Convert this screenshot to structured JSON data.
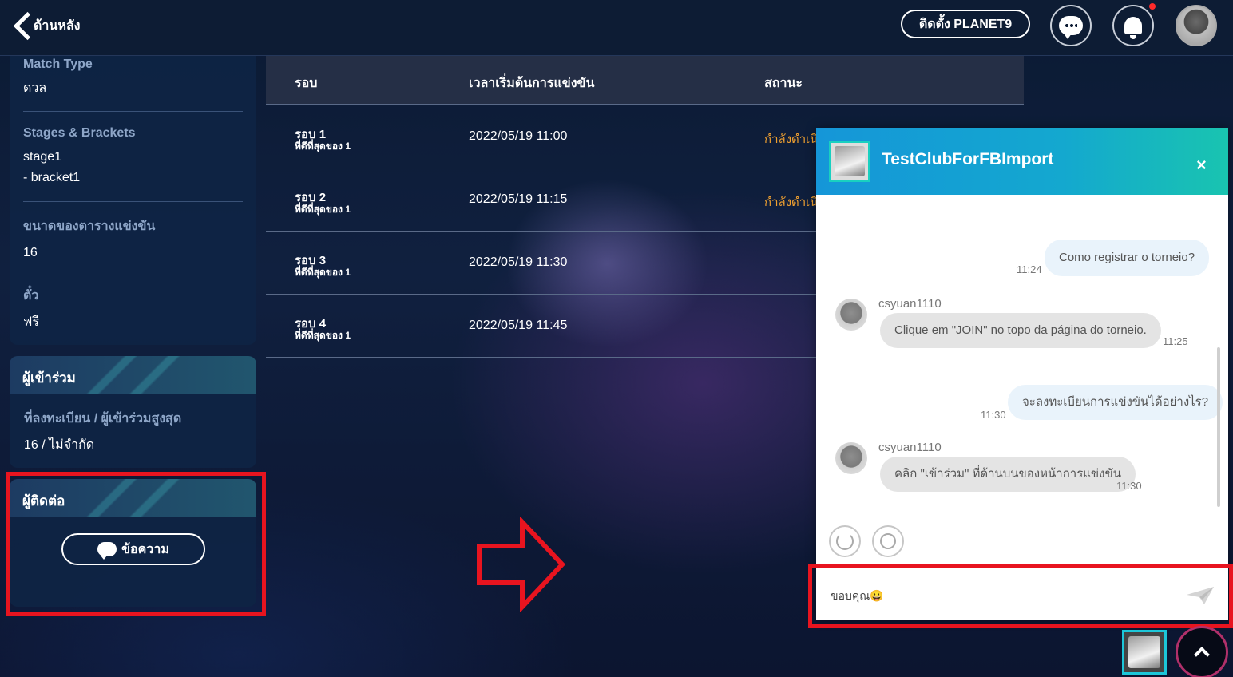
{
  "header": {
    "back_label": "ด้านหลัง",
    "install_label": "ติดตั้ง PLANET9"
  },
  "info": [
    {
      "label": "Match Type",
      "value": "ดวล"
    },
    {
      "label": "Stages & Brackets",
      "value": "stage1",
      "value2": "- bracket1"
    },
    {
      "label": "ขนาดของตารางแข่งขัน",
      "value": "16"
    },
    {
      "label": "ตั๋ว",
      "value": "ฟรี"
    }
  ],
  "participants": {
    "title": "ผู้เข้าร่วม",
    "label": "ที่ลงทะเบียน / ผู้เข้าร่วมสูงสุด",
    "value": "16 / ไม่จำกัด"
  },
  "contact": {
    "title": "ผู้ติดต่อ",
    "message_label": "ข้อความ"
  },
  "table": {
    "headers": [
      "รอบ",
      "เวลาเริ่มต้นการแข่งขัน",
      "สถานะ"
    ],
    "rows": [
      {
        "round": "รอบ 1",
        "sub": "ที่ดีที่สุดของ 1",
        "time": "2022/05/19 11:00",
        "status": "กำลังดำเนิ"
      },
      {
        "round": "รอบ 2",
        "sub": "ที่ดีที่สุดของ 1",
        "time": "2022/05/19 11:15",
        "status": "กำลังดำเนิ"
      },
      {
        "round": "รอบ 3",
        "sub": "ที่ดีที่สุดของ 1",
        "time": "2022/05/19 11:30",
        "status": ""
      },
      {
        "round": "รอบ 4",
        "sub": "ที่ดีที่สุดของ 1",
        "time": "2022/05/19 11:45",
        "status": ""
      }
    ]
  },
  "chat": {
    "title": "TestClubForFBImport",
    "close": "×",
    "messages": [
      {
        "dir": "out",
        "text": "Como registrar o torneio?",
        "time": "11:24"
      },
      {
        "dir": "in",
        "sender": "csyuan1110",
        "text": "Clique em \"JOIN\" no topo da página do torneio.",
        "time": "11:25"
      },
      {
        "dir": "out",
        "text": "จะลงทะเบียนการแข่งขันได้อย่างไร?",
        "time": "11:30"
      },
      {
        "dir": "in",
        "sender": "csyuan1110",
        "text": "คลิก \"เข้าร่วม\" ที่ด้านบนของหน้าการแข่งขัน",
        "time": "11:30"
      }
    ],
    "input_value": "ขอบคุณ😀"
  },
  "colors": {
    "annotation_red": "#e8141f",
    "status_orange": "#f0a030",
    "chat_header_start": "#1596d8",
    "chat_header_end": "#19c4b0"
  }
}
